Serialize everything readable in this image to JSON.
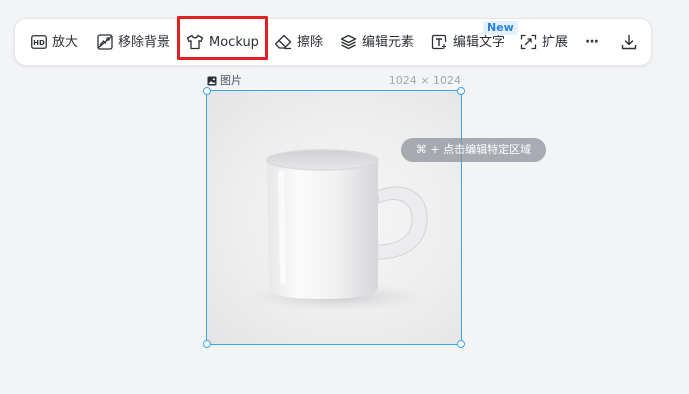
{
  "toolbar": {
    "upscale_label": "放大",
    "remove_bg_label": "移除背景",
    "mockup_label": "Mockup",
    "erase_label": "擦除",
    "edit_elements_label": "编辑元素",
    "edit_text_label": "编辑文字",
    "new_badge": "New",
    "expand_label": "扩展",
    "more_label": "···",
    "upscale_icon": "HD",
    "icons": {
      "upscale": "hd-icon",
      "remove_bg": "remove-background-icon",
      "mockup": "tshirt-icon",
      "erase": "eraser-icon",
      "edit_elements": "layers-icon",
      "edit_text": "text-box-icon",
      "expand": "expand-icon",
      "more": "more-icon",
      "download": "download-icon"
    },
    "highlight_color": "#e02222"
  },
  "canvas": {
    "image_label": "图片",
    "image_dimensions": "1024 × 1024",
    "hint_text": "⌘ + 点击编辑特定区域",
    "selection_color": "#38a8e0",
    "image_content": "white-mug"
  }
}
